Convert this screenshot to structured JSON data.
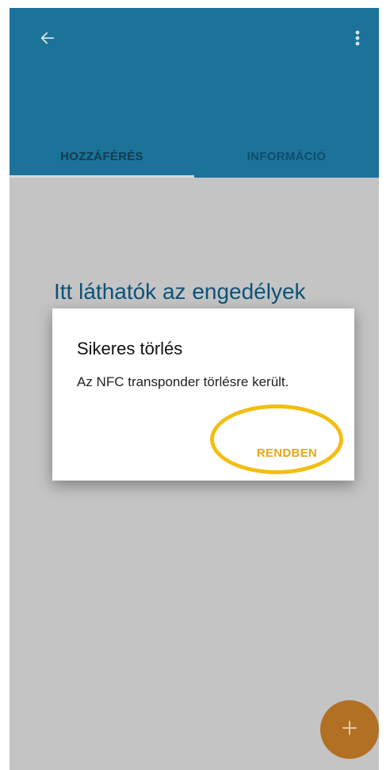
{
  "tabs": [
    {
      "label": "HOZZÁFÉRÉS",
      "active": true
    },
    {
      "label": "INFORMÁCIÓ",
      "active": false
    }
  ],
  "main": {
    "headline": "Itt láthatók az engedélyek"
  },
  "dialog": {
    "title": "Sikeres törlés",
    "message": "Az NFC transponder törlésre került.",
    "ok_label": "RENDBEN"
  },
  "icons": {
    "back": "arrow-left",
    "menu": "more-vertical",
    "fab": "plus"
  },
  "colors": {
    "app_bar": "#1b7399",
    "scrim_background": "#c4c4c4",
    "headline_text": "#0e5277",
    "accent": "#e8a818",
    "fab": "#b27025",
    "highlight_ring": "#f2be11"
  }
}
